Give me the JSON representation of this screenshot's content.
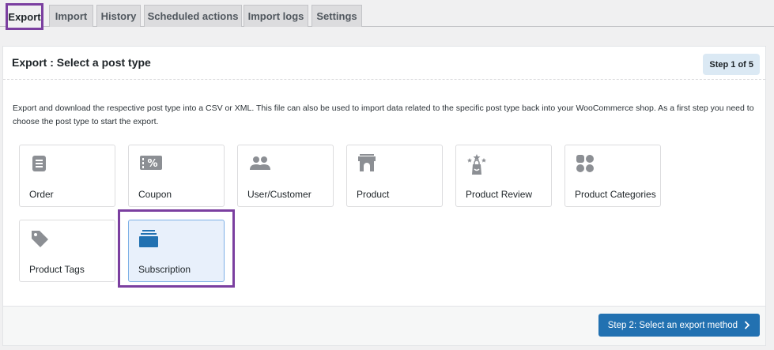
{
  "tabs": [
    {
      "label": "Export",
      "active": true
    },
    {
      "label": "Import"
    },
    {
      "label": "History"
    },
    {
      "label": "Scheduled actions"
    },
    {
      "label": "Import logs"
    },
    {
      "label": "Settings"
    }
  ],
  "panel": {
    "title": "Export : Select a post type",
    "step": "Step 1 of 5",
    "description": "Export and download the respective post type into a CSV or XML. This file can also be used to import data related to the specific post type back into your WooCommerce shop. As a first step you need to choose the post type to start the export."
  },
  "post_types": [
    {
      "label": "Order",
      "icon": "order-icon"
    },
    {
      "label": "Coupon",
      "icon": "coupon-icon"
    },
    {
      "label": "User/Customer",
      "icon": "users-icon"
    },
    {
      "label": "Product",
      "icon": "product-icon"
    },
    {
      "label": "Product Review",
      "icon": "product-review-icon"
    },
    {
      "label": "Product Categories",
      "icon": "categories-icon"
    },
    {
      "label": "Product Tags",
      "icon": "tag-icon"
    },
    {
      "label": "Subscription",
      "icon": "subscription-icon",
      "selected": true
    }
  ],
  "footer": {
    "next_label": "Step 2: Select an export method"
  },
  "colors": {
    "accent": "#2271b1",
    "highlight": "#7b3fa0",
    "icon_gray": "#8c8f94",
    "selected_bg": "#e8f0fb"
  }
}
